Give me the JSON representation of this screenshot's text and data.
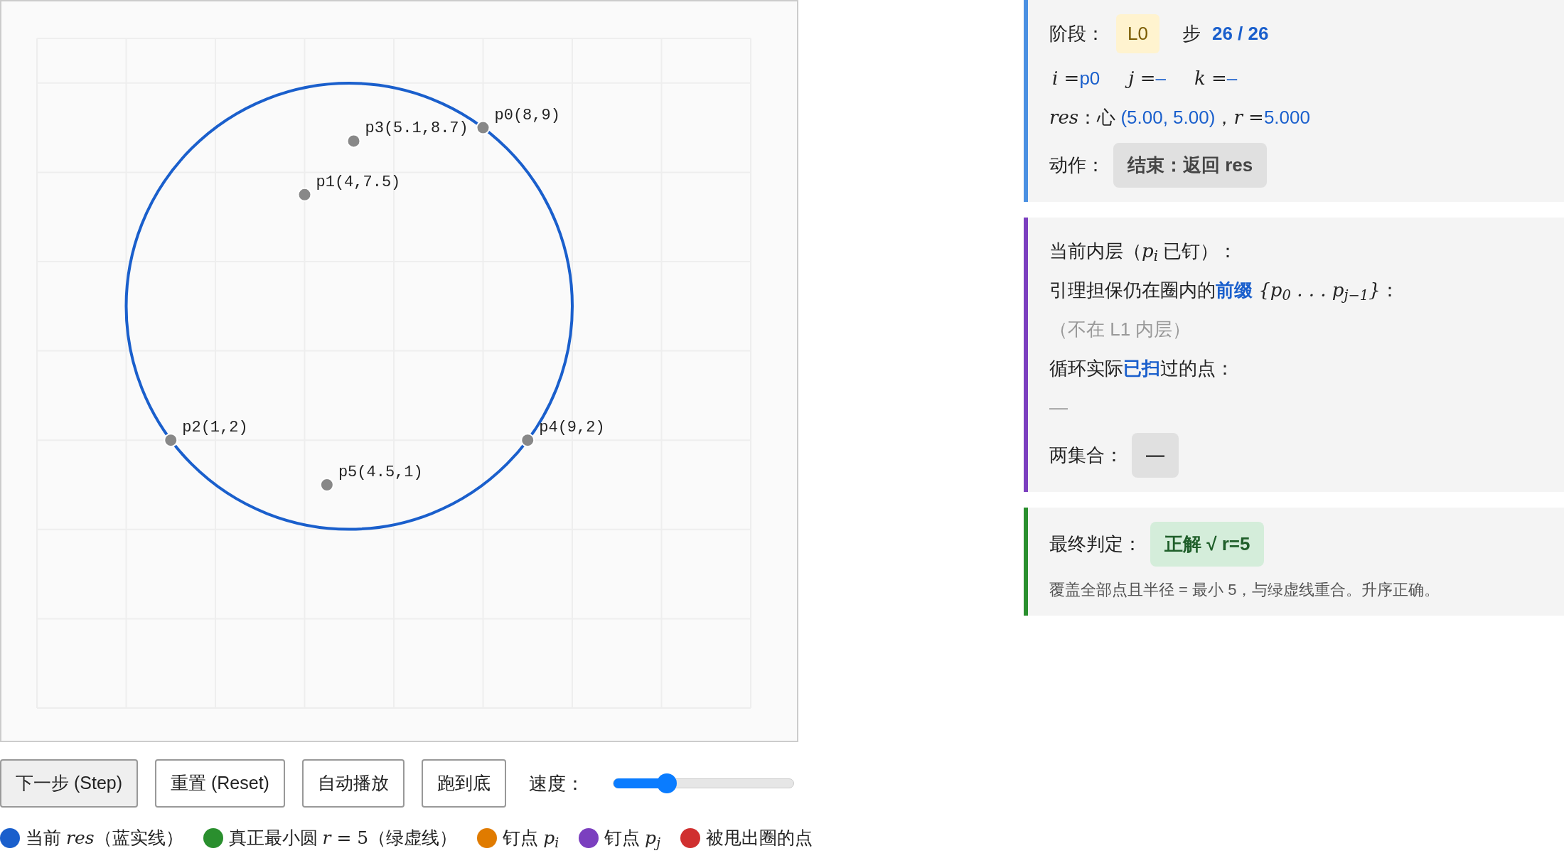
{
  "plot": {
    "points": [
      {
        "label": "p0(8,9)"
      },
      {
        "label": "p1(4,7.5)"
      },
      {
        "label": "p2(1,2)"
      },
      {
        "label": "p3(5.1,8.7)"
      },
      {
        "label": "p4(9,2)"
      },
      {
        "label": "p5(4.5,1)"
      }
    ]
  },
  "controls": {
    "buttons": [
      {
        "label": "下一步 (Step)",
        "pressed": true
      },
      {
        "label": "重置 (Reset)",
        "pressed": false
      },
      {
        "label": "自动播放",
        "pressed": false
      },
      {
        "label": "跑到底",
        "pressed": false
      }
    ],
    "speed": {
      "label": "速度：",
      "level": 0.3
    }
  },
  "legend": [
    {
      "color": "#1a5fcc",
      "parts": [
        {
          "kind": "text",
          "text": "当前 "
        },
        {
          "kind": "math",
          "text": "res"
        },
        {
          "kind": "text",
          "text": "（蓝实线）"
        }
      ]
    },
    {
      "color": "#2a8f2e",
      "parts": [
        {
          "kind": "text",
          "text": "真正最小圆 "
        },
        {
          "kind": "math",
          "text": "r"
        },
        {
          "kind": "plain",
          "text": " = 5"
        },
        {
          "kind": "text",
          "text": "（绿虚线）"
        }
      ]
    },
    {
      "color": "#e07b00",
      "parts": [
        {
          "kind": "text",
          "text": "钉点 "
        },
        {
          "kind": "math",
          "text": "p$_{i}$"
        }
      ]
    },
    {
      "color": "#7b3fbf",
      "parts": [
        {
          "kind": "text",
          "text": "钉点 "
        },
        {
          "kind": "math",
          "text": "p$_{j}$"
        }
      ]
    },
    {
      "color": "#d03030",
      "parts": [
        {
          "kind": "text",
          "text": "被甩出圈的点"
        }
      ]
    }
  ],
  "state_card": {
    "color": "#4a90e2",
    "stage_label": "阶段：",
    "stage": "L0",
    "step_label": "步",
    "step": "26 / 26",
    "variables": [
      {
        "name": "i",
        "eq": "=",
        "value": "p0"
      },
      {
        "name": "j",
        "eq": "=",
        "value": "–"
      },
      {
        "name": "k",
        "eq": "=",
        "value": "–"
      }
    ],
    "res_line": [
      {
        "kind": "math",
        "text": "res"
      },
      {
        "kind": "text",
        "text": "：心 "
      },
      {
        "kind": "value",
        "text": "(5.00, 5.00)"
      },
      {
        "kind": "text",
        "text": "，"
      },
      {
        "kind": "math",
        "text": "r"
      },
      {
        "kind": "plain",
        "text": " ="
      },
      {
        "kind": "value",
        "text": "5.000"
      }
    ],
    "action_label": "动作：",
    "action": "结束：返回 res"
  },
  "inner_card": {
    "color": "#7b3fbf",
    "title": [
      {
        "kind": "text",
        "text": "当前内层（"
      },
      {
        "kind": "math",
        "text": "p$_{i}$"
      },
      {
        "kind": "text",
        "text": " 已钉）："
      }
    ],
    "prefix_line": [
      {
        "kind": "text",
        "text": "引理担保仍在圈内的"
      },
      {
        "kind": "strong",
        "text": "前缀"
      },
      {
        "kind": "math",
        "text": " {p$_{0}$ . . . p$_{j−1}$}"
      },
      {
        "kind": "text",
        "text": "："
      }
    ],
    "prefix_note": "（不在 L1 内层）",
    "scanned_line": [
      {
        "kind": "text",
        "text": "循环实际"
      },
      {
        "kind": "strong",
        "text": "已扫"
      },
      {
        "kind": "text",
        "text": "过的点："
      }
    ],
    "scanned_value": "—",
    "sets_label": "两集合：",
    "sets_value": "—"
  },
  "verdict_card": {
    "color": "#2a8f2e",
    "label": "最终判定：",
    "verdict": "正解 √ r=5",
    "note": "覆盖全部点且半径 = 最小 5，与绿虚线重合。升序正确。"
  }
}
